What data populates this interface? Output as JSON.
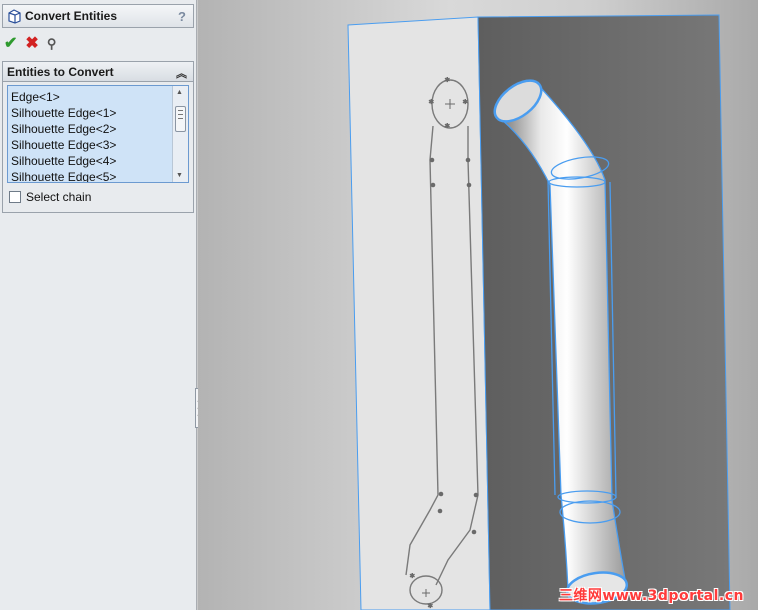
{
  "panel": {
    "title": "Convert Entities",
    "help": "?",
    "group_title": "Entities to Convert",
    "entities": [
      "Edge<1>",
      "Silhouette Edge<1>",
      "Silhouette Edge<2>",
      "Silhouette Edge<3>",
      "Silhouette Edge<4>",
      "Silhouette Edge<5>"
    ],
    "select_chain_label": "Select chain",
    "select_chain_checked": false,
    "icons": {
      "ok": "check-icon",
      "cancel": "x-icon",
      "pin": "pushpin-icon",
      "feature": "cube-icon"
    }
  },
  "watermark": "三维网www.3dportal.cn",
  "colors": {
    "selection": "#4a9df0",
    "sketch_line": "#7a7a7a",
    "list_bg": "#cfe3f7",
    "ok": "#2e9a2e",
    "cancel": "#d22222"
  }
}
